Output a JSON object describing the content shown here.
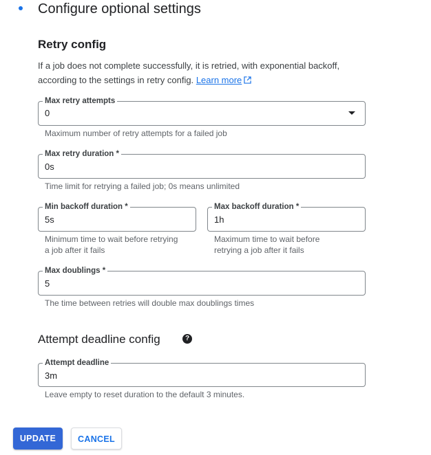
{
  "header": {
    "title": "Configure optional settings"
  },
  "retry": {
    "heading": "Retry config",
    "description": "If a job does not complete successfully, it is retried, with exponential backoff, according to the settings in retry config.",
    "learn_more": "Learn more",
    "max_attempts": {
      "label": "Max retry attempts",
      "value": "0",
      "hint": "Maximum number of retry attempts for a failed job"
    },
    "max_duration": {
      "label": "Max retry duration *",
      "value": "0s",
      "hint": "Time limit for retrying a failed job; 0s means unlimited"
    },
    "min_backoff": {
      "label": "Min backoff duration *",
      "value": "5s",
      "hint_line1": "Minimum time to wait before retrying",
      "hint_line2": "a job after it fails"
    },
    "max_backoff": {
      "label": "Max backoff duration *",
      "value": "1h",
      "hint_line1": "Maximum time to wait before",
      "hint_line2": "retrying a job after it fails"
    },
    "max_doublings": {
      "label": "Max doublings *",
      "value": "5",
      "hint": "The time between retries will double max doublings times"
    }
  },
  "deadline": {
    "heading": "Attempt deadline config",
    "help_icon": "help-circle-icon",
    "field": {
      "label": "Attempt deadline",
      "value": "3m",
      "hint": "Leave empty to reset duration to the default 3 minutes."
    }
  },
  "actions": {
    "update_label": "UPDATE",
    "cancel_label": "CANCEL"
  },
  "colors": {
    "accent": "#1a73e8",
    "primary_button": "#3367d6"
  }
}
